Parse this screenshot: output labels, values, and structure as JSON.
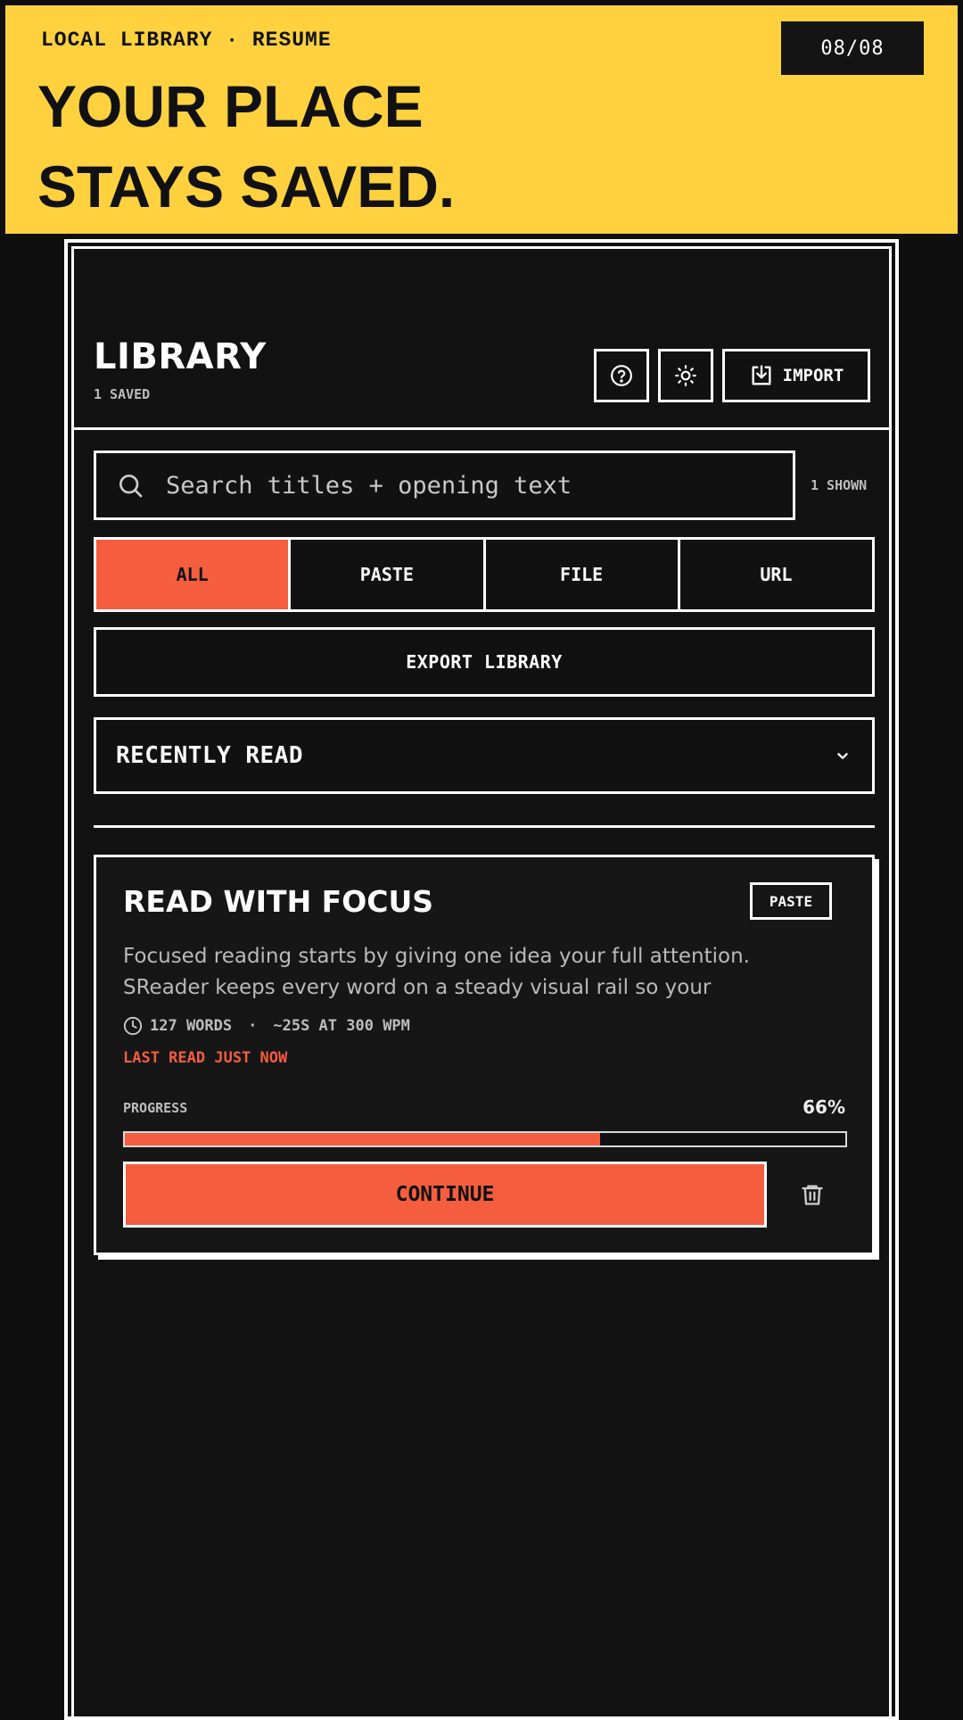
{
  "banner": {
    "eyebrow": "LOCAL LIBRARY · RESUME",
    "headline_line1": "YOUR PLACE",
    "headline_line2": "STAYS SAVED.",
    "counter": "08/08",
    "color": "#ffd13f"
  },
  "library": {
    "title": "LIBRARY",
    "saved_count": "1 SAVED",
    "help_icon": "help-circle-icon",
    "theme_icon": "sun-icon",
    "import_label": "IMPORT",
    "import_icon": "download-icon"
  },
  "search": {
    "placeholder": "Search titles + opening text",
    "value": "",
    "shown": "1 SHOWN"
  },
  "filters": {
    "items": [
      "ALL",
      "PASTE",
      "FILE",
      "URL"
    ],
    "active": "ALL"
  },
  "export_label": "EXPORT LIBRARY",
  "sort": {
    "selected": "RECENTLY READ",
    "icon": "chevron-down-icon"
  },
  "card": {
    "title": "READ WITH FOCUS",
    "badge": "PASTE",
    "excerpt": "Focused reading starts by giving one idea your full attention. SReader keeps every word on a steady visual rail so your",
    "words": "127 WORDS",
    "separator": "·",
    "duration": "~25S AT 300 WPM",
    "last_read": "LAST READ JUST NOW",
    "progress_label": "PROGRESS",
    "progress_text": "66%",
    "progress": 0.66,
    "continue_label": "CONTINUE",
    "delete_icon": "trash-icon"
  },
  "colors": {
    "accent": "#f45d3e",
    "background": "#121212",
    "foreground": "#ffffff"
  }
}
